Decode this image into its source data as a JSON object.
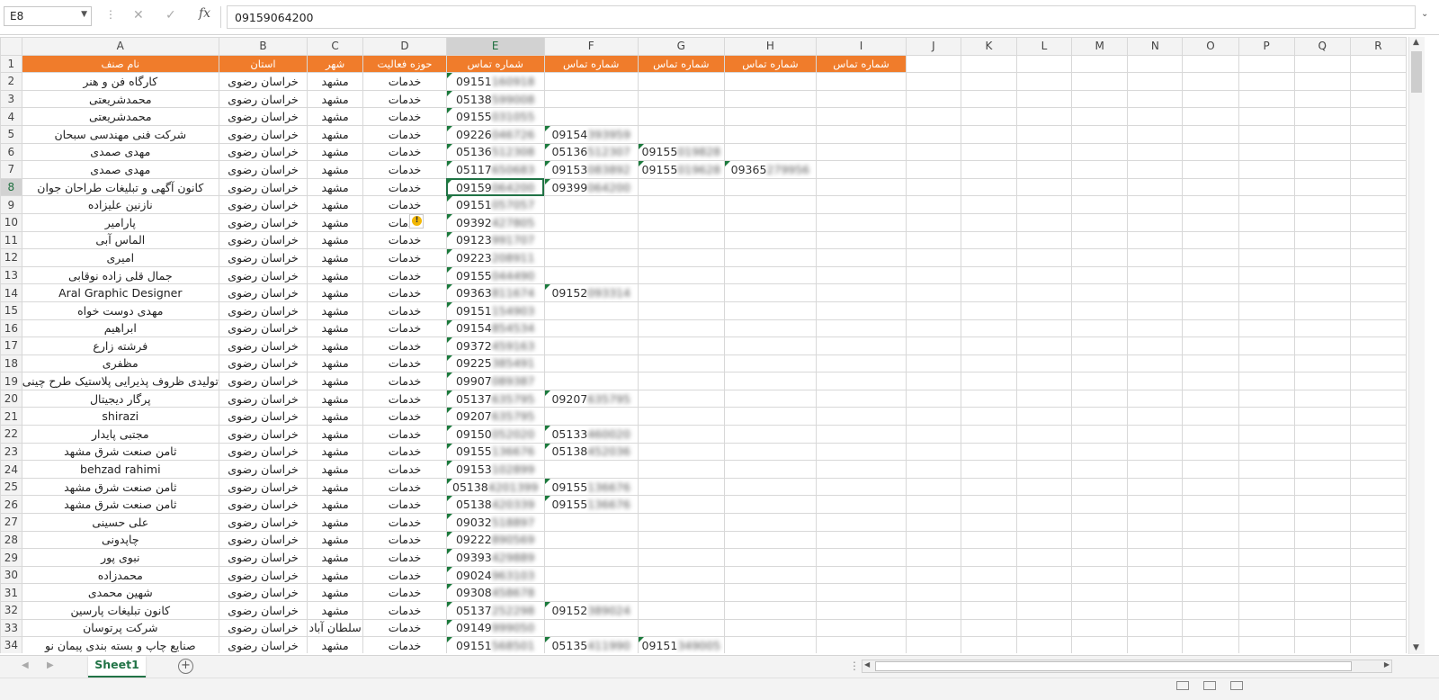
{
  "formula_bar": {
    "name_box": "E8",
    "dots": "⋮",
    "cancel_icon": "✕",
    "enter_icon": "✓",
    "fx_label": "fx",
    "formula_value": "09159064200",
    "expand_icon": "⌄"
  },
  "sheet": {
    "columns": [
      "A",
      "B",
      "C",
      "D",
      "E",
      "F",
      "G",
      "H",
      "I",
      "J",
      "K",
      "L",
      "M",
      "N",
      "O",
      "P",
      "Q",
      "R"
    ],
    "selected_column": "E",
    "selected_row": 8,
    "header_row": [
      "نام صنف",
      "استان",
      "شهر",
      "حوزه فعالیت",
      "شماره تماس",
      "شماره تماس",
      "شماره تماس",
      "شماره تماس",
      "شماره تماس"
    ],
    "rows": [
      {
        "n": "2",
        "a": "کارگاه فن و هنر",
        "b": "خراسان رضوی",
        "c": "مشهد",
        "d": "خدمات",
        "e": "09151160918",
        "f": "",
        "g": "",
        "h": ""
      },
      {
        "n": "3",
        "a": "محمدشریعتی",
        "b": "خراسان رضوی",
        "c": "مشهد",
        "d": "خدمات",
        "e": "05138599008",
        "f": "",
        "g": "",
        "h": ""
      },
      {
        "n": "4",
        "a": "محمدشریعتی",
        "b": "خراسان رضوی",
        "c": "مشهد",
        "d": "خدمات",
        "e": "09155031055",
        "f": "",
        "g": "",
        "h": ""
      },
      {
        "n": "5",
        "a": "شرکت فنی مهندسی سبحان",
        "b": "خراسان رضوی",
        "c": "مشهد",
        "d": "خدمات",
        "e": "09226046726",
        "f": "09154393959",
        "g": "",
        "h": ""
      },
      {
        "n": "6",
        "a": "مهدی صمدی",
        "b": "خراسان رضوی",
        "c": "مشهد",
        "d": "خدمات",
        "e": "05136512308",
        "f": "05136512307",
        "g": "09155019828",
        "h": ""
      },
      {
        "n": "7",
        "a": "مهدی صمدی",
        "b": "خراسان رضوی",
        "c": "مشهد",
        "d": "خدمات",
        "e": "05117650683",
        "f": "09153083892",
        "g": "09155019628",
        "h": "09365279956"
      },
      {
        "n": "8",
        "a": "کانون آگهی و تبلیغات طراحان جوان",
        "b": "خراسان رضوی",
        "c": "مشهد",
        "d": "خدمات",
        "e": "09159064200",
        "f": "09399064200",
        "g": "",
        "h": ""
      },
      {
        "n": "9",
        "a": "نازنین علیزاده",
        "b": "خراسان رضوی",
        "c": "مشهد",
        "d": "خدمات",
        "e": "09151057057",
        "f": "",
        "g": "",
        "h": ""
      },
      {
        "n": "10",
        "a": "پارامیر",
        "b": "خراسان رضوی",
        "c": "مشهد",
        "d": "خدمات",
        "e": "09392427805",
        "f": "",
        "g": "",
        "h": ""
      },
      {
        "n": "11",
        "a": "الماس آبی",
        "b": "خراسان رضوی",
        "c": "مشهد",
        "d": "خدمات",
        "e": "09123991707",
        "f": "",
        "g": "",
        "h": ""
      },
      {
        "n": "12",
        "a": "امیری",
        "b": "خراسان رضوی",
        "c": "مشهد",
        "d": "خدمات",
        "e": "09223208911",
        "f": "",
        "g": "",
        "h": ""
      },
      {
        "n": "13",
        "a": "جمال قلی زاده نوقابی",
        "b": "خراسان رضوی",
        "c": "مشهد",
        "d": "خدمات",
        "e": "09155044490",
        "f": "",
        "g": "",
        "h": ""
      },
      {
        "n": "14",
        "a": "Aral Graphic Designer",
        "b": "خراسان رضوی",
        "c": "مشهد",
        "d": "خدمات",
        "e": "09363811674",
        "f": "09152093314",
        "g": "",
        "h": ""
      },
      {
        "n": "15",
        "a": "مهدی دوست خواه",
        "b": "خراسان رضوی",
        "c": "مشهد",
        "d": "خدمات",
        "e": "09151154903",
        "f": "",
        "g": "",
        "h": ""
      },
      {
        "n": "16",
        "a": "ابراهیم",
        "b": "خراسان رضوی",
        "c": "مشهد",
        "d": "خدمات",
        "e": "09154854534",
        "f": "",
        "g": "",
        "h": ""
      },
      {
        "n": "17",
        "a": "فرشته زارع",
        "b": "خراسان رضوی",
        "c": "مشهد",
        "d": "خدمات",
        "e": "09372459163",
        "f": "",
        "g": "",
        "h": ""
      },
      {
        "n": "18",
        "a": "مظفری",
        "b": "خراسان رضوی",
        "c": "مشهد",
        "d": "خدمات",
        "e": "09225385491",
        "f": "",
        "g": "",
        "h": ""
      },
      {
        "n": "19",
        "a": "تولیدی ظروف پذیرایی پلاستیک طرح چینی",
        "b": "خراسان رضوی",
        "c": "مشهد",
        "d": "خدمات",
        "e": "09907089387",
        "f": "",
        "g": "",
        "h": ""
      },
      {
        "n": "20",
        "a": "پرگار دیجیتال",
        "b": "خراسان رضوی",
        "c": "مشهد",
        "d": "خدمات",
        "e": "05137635795",
        "f": "09207635795",
        "g": "",
        "h": ""
      },
      {
        "n": "21",
        "a": "shirazi",
        "b": "خراسان رضوی",
        "c": "مشهد",
        "d": "خدمات",
        "e": "09207635795",
        "f": "",
        "g": "",
        "h": ""
      },
      {
        "n": "22",
        "a": "مجتبی پایدار",
        "b": "خراسان رضوی",
        "c": "مشهد",
        "d": "خدمات",
        "e": "09150052020",
        "f": "05133460020",
        "g": "",
        "h": ""
      },
      {
        "n": "23",
        "a": "ثامن صنعت شرق مشهد",
        "b": "خراسان رضوی",
        "c": "مشهد",
        "d": "خدمات",
        "e": "09155136676",
        "f": "05138452036",
        "g": "",
        "h": ""
      },
      {
        "n": "24",
        "a": "behzad rahimi",
        "b": "خراسان رضوی",
        "c": "مشهد",
        "d": "خدمات",
        "e": "09153102899",
        "f": "",
        "g": "",
        "h": ""
      },
      {
        "n": "25",
        "a": "ثامن صنعت شرق مشهد",
        "b": "خراسان رضوی",
        "c": "مشهد",
        "d": "خدمات",
        "e": "051384201399",
        "f": "09155136676",
        "g": "",
        "h": ""
      },
      {
        "n": "26",
        "a": "ثامن صنعت شرق مشهد",
        "b": "خراسان رضوی",
        "c": "مشهد",
        "d": "خدمات",
        "e": "05138420339",
        "f": "09155136676",
        "g": "",
        "h": ""
      },
      {
        "n": "27",
        "a": "علی حسینی",
        "b": "خراسان رضوی",
        "c": "مشهد",
        "d": "خدمات",
        "e": "09032518897",
        "f": "",
        "g": "",
        "h": ""
      },
      {
        "n": "28",
        "a": "چاپدونی",
        "b": "خراسان رضوی",
        "c": "مشهد",
        "d": "خدمات",
        "e": "09222890569",
        "f": "",
        "g": "",
        "h": ""
      },
      {
        "n": "29",
        "a": "نبوی پور",
        "b": "خراسان رضوی",
        "c": "مشهد",
        "d": "خدمات",
        "e": "09393429889",
        "f": "",
        "g": "",
        "h": ""
      },
      {
        "n": "30",
        "a": "محمدزاده",
        "b": "خراسان رضوی",
        "c": "مشهد",
        "d": "خدمات",
        "e": "09024963103",
        "f": "",
        "g": "",
        "h": ""
      },
      {
        "n": "31",
        "a": "شهین محمدی",
        "b": "خراسان رضوی",
        "c": "مشهد",
        "d": "خدمات",
        "e": "09308458678",
        "f": "",
        "g": "",
        "h": ""
      },
      {
        "n": "32",
        "a": "کانون تبلیغات پارسین",
        "b": "خراسان رضوی",
        "c": "مشهد",
        "d": "خدمات",
        "e": "05137252298",
        "f": "09152389024",
        "g": "",
        "h": ""
      },
      {
        "n": "33",
        "a": "شرکت پرتوسان",
        "b": "خراسان رضوی",
        "c": "سلطان آباد",
        "d": "خدمات",
        "e": "09149999050",
        "f": "",
        "g": "",
        "h": ""
      },
      {
        "n": "34",
        "a": "صنایع چاپ و بسته بندی پیمان نو",
        "b": "خراسان رضوی",
        "c": "مشهد",
        "d": "خدمات",
        "e": "09151568501",
        "f": "05135411990",
        "g": "09151349005",
        "h": ""
      }
    ]
  },
  "tabs": {
    "prev_icon": "◀",
    "next_icon": "▶",
    "sheet_name": "Sheet1",
    "add_icon": "+",
    "split_icon": "⋮"
  },
  "scrollbars": {
    "up_icon": "▲",
    "down_icon": "▼",
    "left_icon": "◀",
    "right_icon": "▶"
  }
}
